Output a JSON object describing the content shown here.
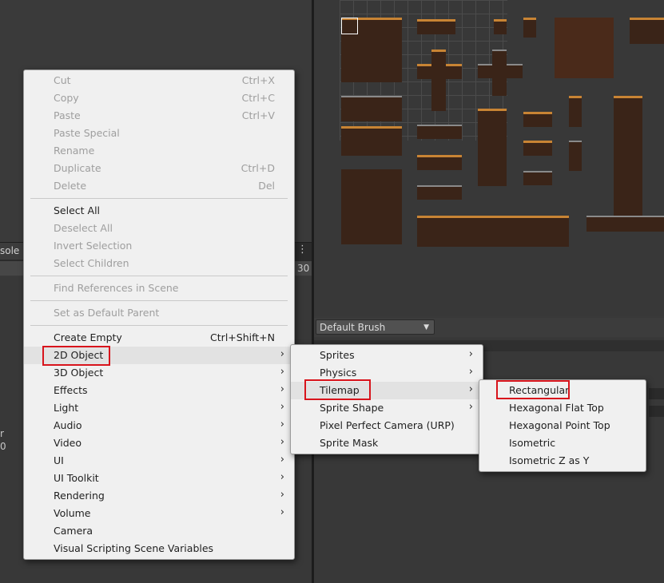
{
  "background": {
    "console_tab": "sole",
    "left_number": "30",
    "left_stub_1": "r",
    "left_stub_2": "0",
    "brush_dropdown": "Default Brush"
  },
  "context_menu": {
    "groups": [
      [
        {
          "label": "Cut",
          "shortcut": "Ctrl+X",
          "enabled": false
        },
        {
          "label": "Copy",
          "shortcut": "Ctrl+C",
          "enabled": false
        },
        {
          "label": "Paste",
          "shortcut": "Ctrl+V",
          "enabled": false
        },
        {
          "label": "Paste Special",
          "shortcut": "",
          "enabled": false
        },
        {
          "label": "Rename",
          "shortcut": "",
          "enabled": false
        },
        {
          "label": "Duplicate",
          "shortcut": "Ctrl+D",
          "enabled": false
        },
        {
          "label": "Delete",
          "shortcut": "Del",
          "enabled": false
        }
      ],
      [
        {
          "label": "Select All",
          "enabled": true
        },
        {
          "label": "Deselect All",
          "enabled": false
        },
        {
          "label": "Invert Selection",
          "enabled": false
        },
        {
          "label": "Select Children",
          "enabled": false
        }
      ],
      [
        {
          "label": "Find References in Scene",
          "enabled": false
        }
      ],
      [
        {
          "label": "Set as Default Parent",
          "enabled": false
        }
      ]
    ],
    "create_items": [
      {
        "label": "Create Empty",
        "shortcut": "Ctrl+Shift+N",
        "submenu": false
      },
      {
        "label": "2D Object",
        "submenu": true,
        "highlighted": true
      },
      {
        "label": "3D Object",
        "submenu": true
      },
      {
        "label": "Effects",
        "submenu": true
      },
      {
        "label": "Light",
        "submenu": true
      },
      {
        "label": "Audio",
        "submenu": true
      },
      {
        "label": "Video",
        "submenu": true
      },
      {
        "label": "UI",
        "submenu": true
      },
      {
        "label": "UI Toolkit",
        "submenu": true
      },
      {
        "label": "Rendering",
        "submenu": true
      },
      {
        "label": "Volume",
        "submenu": true
      },
      {
        "label": "Camera",
        "submenu": false
      },
      {
        "label": "Visual Scripting Scene Variables",
        "submenu": false
      }
    ]
  },
  "submenu_2d": {
    "items": [
      {
        "label": "Sprites",
        "submenu": true
      },
      {
        "label": "Physics",
        "submenu": true
      },
      {
        "label": "Tilemap",
        "submenu": true,
        "highlighted": true
      },
      {
        "label": "Sprite Shape",
        "submenu": true
      },
      {
        "label": "Pixel Perfect Camera (URP)",
        "submenu": false
      },
      {
        "label": "Sprite Mask",
        "submenu": false
      }
    ]
  },
  "submenu_tilemap": {
    "items": [
      {
        "label": "Rectangular"
      },
      {
        "label": "Hexagonal Flat Top"
      },
      {
        "label": "Hexagonal Point Top"
      },
      {
        "label": "Isometric"
      },
      {
        "label": "Isometric Z as Y"
      }
    ]
  },
  "icons": {
    "chevron": "chevron-right-icon",
    "kebab": "kebab-menu-icon",
    "dropdown": "dropdown-arrow-icon"
  },
  "colors": {
    "highlight_box": "#d8141c",
    "menu_bg": "#f0f0f0",
    "disabled_text": "#9e9e9e"
  }
}
